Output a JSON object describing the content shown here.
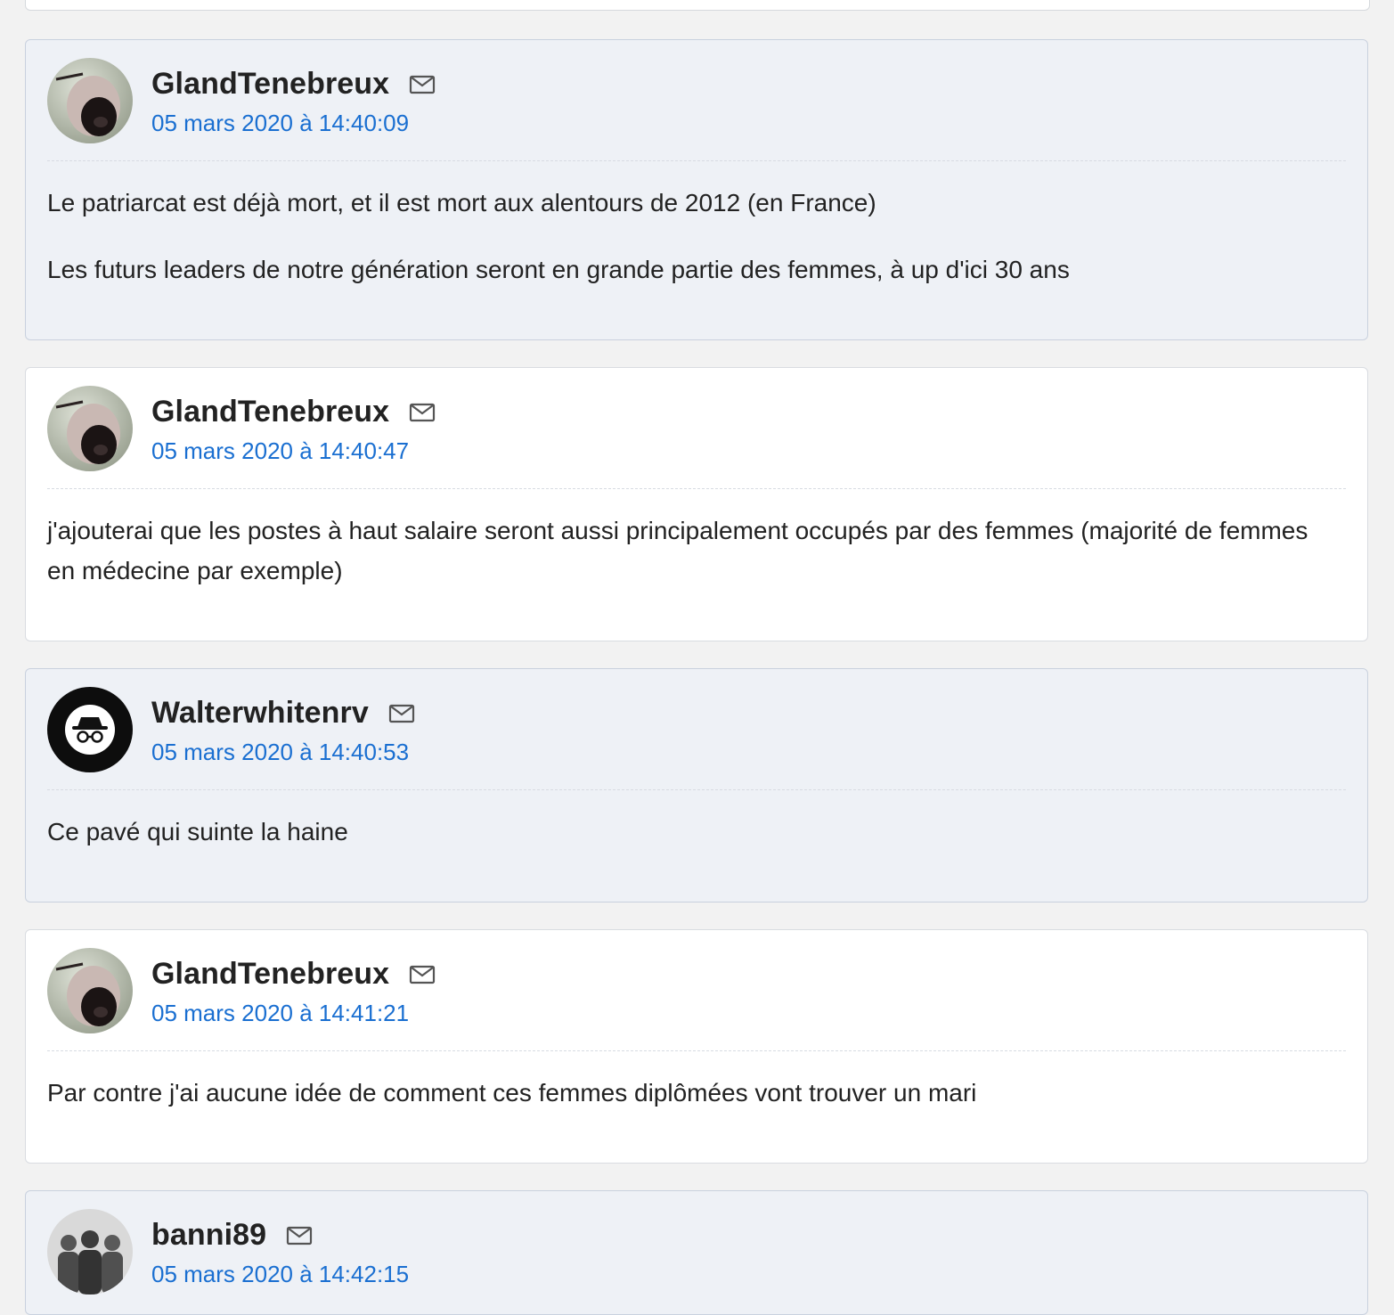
{
  "posts": [
    {
      "author": "GlandTenebreux",
      "date": "05 mars 2020 à 14:40:09",
      "paragraphs": [
        "Le patriarcat est déjà mort, et il est mort aux alentours de 2012 (en France)",
        "Les futurs leaders de notre génération seront en grande partie des femmes, à up d'ici 30 ans"
      ]
    },
    {
      "author": "GlandTenebreux",
      "date": "05 mars 2020 à 14:40:47",
      "paragraphs": [
        "j'ajouterai que les postes à haut salaire seront aussi principalement occupés par des femmes (majorité de femmes en médecine par exemple)"
      ]
    },
    {
      "author": "Walterwhitenrv",
      "date": "05 mars 2020 à 14:40:53",
      "paragraphs": [
        "Ce pavé qui suinte la haine"
      ]
    },
    {
      "author": "GlandTenebreux",
      "date": "05 mars 2020 à 14:41:21",
      "paragraphs": [
        "Par contre j'ai aucune idée de comment ces femmes diplômées vont trouver un mari"
      ]
    },
    {
      "author": "banni89",
      "date": "05 mars 2020 à 14:42:15",
      "paragraphs": []
    }
  ],
  "icons": {
    "mail": "mail-icon"
  },
  "colors": {
    "date_link": "#1a6fd1",
    "alt_post_bg": "#eef1f6",
    "plain_post_bg": "#ffffff"
  }
}
